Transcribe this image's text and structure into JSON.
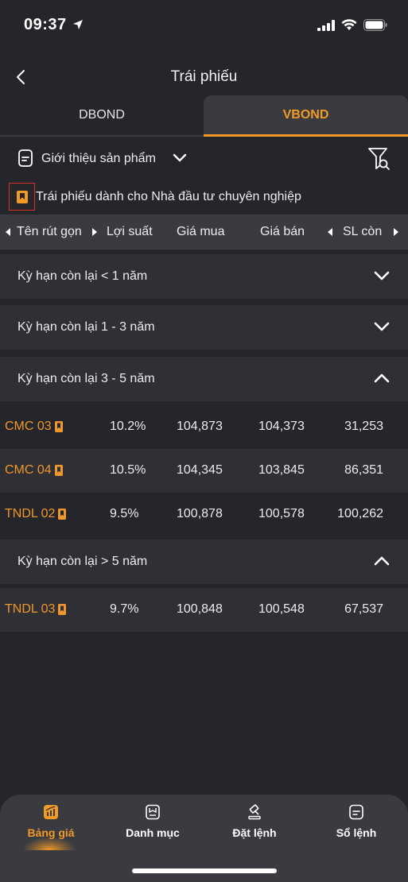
{
  "status_bar": {
    "time": "09:37"
  },
  "nav": {
    "title": "Trái phiếu"
  },
  "tabs": [
    {
      "label": "DBOND",
      "active": false
    },
    {
      "label": "VBOND",
      "active": true
    }
  ],
  "intro": {
    "label": "Giới thiệu sản phẩm"
  },
  "pro_notice": {
    "label": "Trái phiếu dành cho Nhà đầu tư chuyên nghiệp"
  },
  "columns": {
    "code": "Tên rút gọn",
    "yield": "Lợi suất",
    "buy": "Giá mua",
    "sell": "Giá bán",
    "qty": "SL còn"
  },
  "groups": [
    {
      "label": "Kỳ hạn còn lại < 1 năm",
      "expanded": false,
      "rows": []
    },
    {
      "label": "Kỳ hạn còn lại 1 - 3 năm",
      "expanded": false,
      "rows": []
    },
    {
      "label": "Kỳ hạn còn lại 3 - 5 năm",
      "expanded": true,
      "rows": [
        {
          "code": "CMC 03",
          "yield": "10.2%",
          "buy": "104,873",
          "sell": "104,373",
          "qty": "31,253"
        },
        {
          "code": "CMC 04",
          "yield": "10.5%",
          "buy": "104,345",
          "sell": "103,845",
          "qty": "86,351"
        },
        {
          "code": "TNDL 02",
          "yield": "9.5%",
          "buy": "100,878",
          "sell": "100,578",
          "qty": "100,262"
        }
      ]
    },
    {
      "label": "Kỳ hạn còn lại > 5 năm",
      "expanded": true,
      "rows": [
        {
          "code": "TNDL 03",
          "yield": "9.7%",
          "buy": "100,848",
          "sell": "100,548",
          "qty": "67,537"
        }
      ]
    }
  ],
  "bottom_nav": [
    {
      "label": "Bảng giá",
      "icon": "chart-icon",
      "active": true
    },
    {
      "label": "Danh mục",
      "icon": "portfolio-icon",
      "active": false
    },
    {
      "label": "Đặt lệnh",
      "icon": "gavel-icon",
      "active": false
    },
    {
      "label": "Sổ lệnh",
      "icon": "order-book-icon",
      "active": false
    }
  ],
  "colors": {
    "accent": "#f19a26",
    "background": "#25262b",
    "header": "#3a3b41",
    "alert": "#d8312c"
  }
}
